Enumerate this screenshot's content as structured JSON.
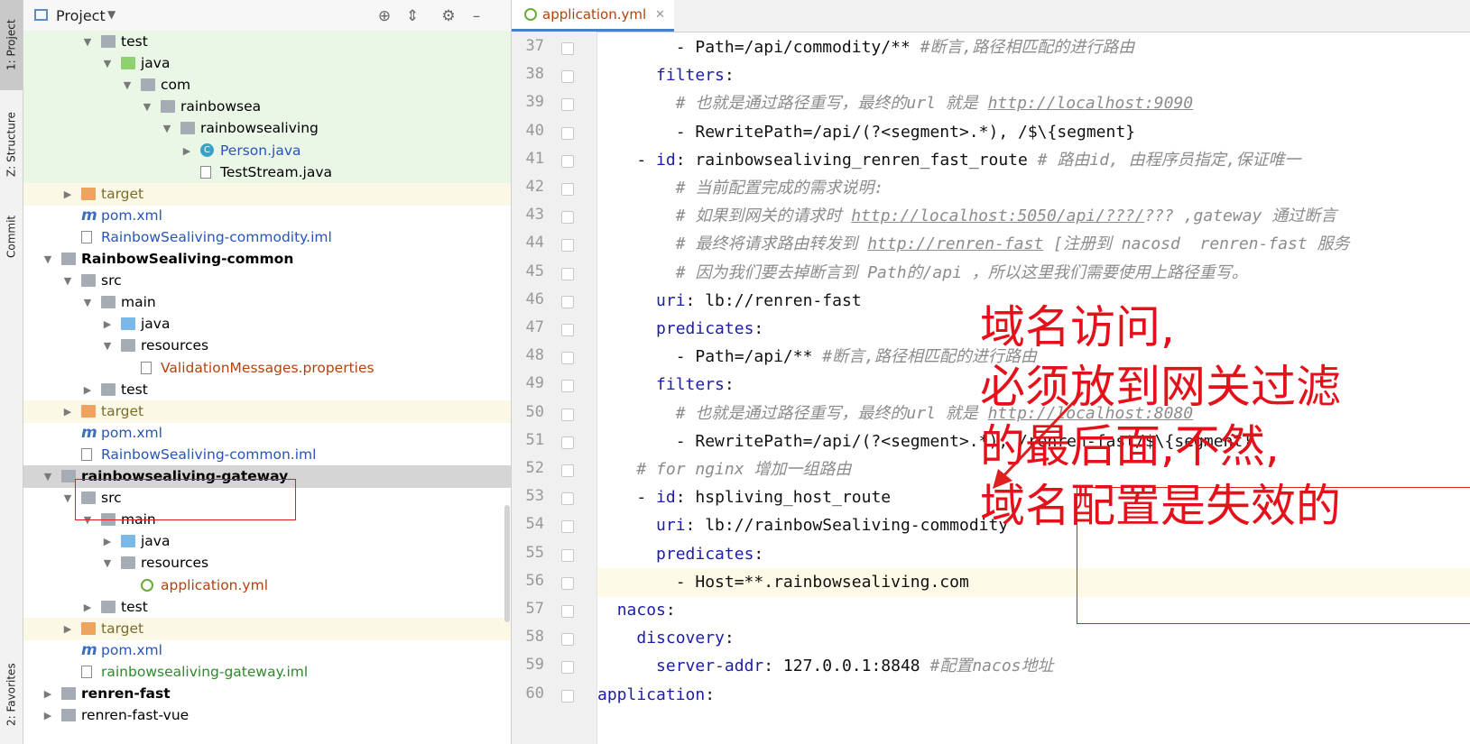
{
  "sidebar_tabs": [
    {
      "label": "1: Project"
    },
    {
      "label": "Z: Structure"
    },
    {
      "label": "Commit"
    },
    {
      "label": "2: Favorites"
    }
  ],
  "project_panel": {
    "title": "Project",
    "tree": [
      {
        "label": "test",
        "depth": 3,
        "arrow": "down",
        "icon": "folder",
        "bg": "green"
      },
      {
        "label": "java",
        "depth": 4,
        "arrow": "down",
        "icon": "folder-src",
        "bg": "green"
      },
      {
        "label": "com",
        "depth": 5,
        "arrow": "down",
        "icon": "package",
        "bg": "green"
      },
      {
        "label": "rainbowsea",
        "depth": 6,
        "arrow": "down",
        "icon": "package",
        "bg": "green"
      },
      {
        "label": "rainbowsealiving",
        "depth": 7,
        "arrow": "down",
        "icon": "package",
        "bg": "green"
      },
      {
        "label": "Person.java",
        "depth": 8,
        "arrow": "right",
        "icon": "class",
        "bg": "green",
        "color": "#2855b8"
      },
      {
        "label": "TestStream.java",
        "depth": 8,
        "arrow": "",
        "icon": "java-file",
        "bg": "green"
      },
      {
        "label": "target",
        "depth": 2,
        "arrow": "right",
        "icon": "folder-orange",
        "bg": "yellow",
        "color": "#7d6b2c"
      },
      {
        "label": "pom.xml",
        "depth": 2,
        "arrow": "",
        "icon": "maven",
        "bg": "",
        "color": "#2855b8"
      },
      {
        "label": "RainbowSealiving-commodity.iml",
        "depth": 2,
        "arrow": "",
        "icon": "iml",
        "bg": "",
        "color": "#2855b8"
      },
      {
        "label": "RainbowSealiving-common",
        "depth": 1,
        "arrow": "down",
        "icon": "module",
        "bg": "",
        "bold": true
      },
      {
        "label": "src",
        "depth": 2,
        "arrow": "down",
        "icon": "folder",
        "bg": ""
      },
      {
        "label": "main",
        "depth": 3,
        "arrow": "down",
        "icon": "folder",
        "bg": ""
      },
      {
        "label": "java",
        "depth": 4,
        "arrow": "right",
        "icon": "folder-blue",
        "bg": ""
      },
      {
        "label": "resources",
        "depth": 4,
        "arrow": "down",
        "icon": "folder-res",
        "bg": ""
      },
      {
        "label": "ValidationMessages.properties",
        "depth": 5,
        "arrow": "",
        "icon": "properties",
        "bg": "",
        "color": "#b5420c"
      },
      {
        "label": "test",
        "depth": 3,
        "arrow": "right",
        "icon": "folder",
        "bg": ""
      },
      {
        "label": "target",
        "depth": 2,
        "arrow": "right",
        "icon": "folder-orange",
        "bg": "yellow",
        "color": "#7d6b2c"
      },
      {
        "label": "pom.xml",
        "depth": 2,
        "arrow": "",
        "icon": "maven",
        "bg": "",
        "color": "#2855b8"
      },
      {
        "label": "RainbowSealiving-common.iml",
        "depth": 2,
        "arrow": "",
        "icon": "iml",
        "bg": "",
        "color": "#2855b8"
      },
      {
        "label": "rainbowsealiving-gateway",
        "depth": 1,
        "arrow": "down",
        "icon": "module",
        "bg": "selected",
        "bold": true
      },
      {
        "label": "src",
        "depth": 2,
        "arrow": "down",
        "icon": "folder",
        "bg": ""
      },
      {
        "label": "main",
        "depth": 3,
        "arrow": "down",
        "icon": "folder",
        "bg": ""
      },
      {
        "label": "java",
        "depth": 4,
        "arrow": "right",
        "icon": "folder-blue",
        "bg": ""
      },
      {
        "label": "resources",
        "depth": 4,
        "arrow": "down",
        "icon": "folder-res",
        "bg": ""
      },
      {
        "label": "application.yml",
        "depth": 5,
        "arrow": "",
        "icon": "yml",
        "bg": "",
        "color": "#b5420c"
      },
      {
        "label": "test",
        "depth": 3,
        "arrow": "right",
        "icon": "folder",
        "bg": ""
      },
      {
        "label": "target",
        "depth": 2,
        "arrow": "right",
        "icon": "folder-orange",
        "bg": "yellow",
        "color": "#7d6b2c"
      },
      {
        "label": "pom.xml",
        "depth": 2,
        "arrow": "",
        "icon": "maven",
        "bg": "",
        "color": "#2855b8"
      },
      {
        "label": "rainbowsealiving-gateway.iml",
        "depth": 2,
        "arrow": "",
        "icon": "iml",
        "bg": "",
        "color": "#2d8a2d"
      },
      {
        "label": "renren-fast",
        "depth": 1,
        "arrow": "right",
        "icon": "module",
        "bg": "",
        "bold": true
      },
      {
        "label": "renren-fast-vue",
        "depth": 1,
        "arrow": "right",
        "icon": "module",
        "bg": ""
      }
    ]
  },
  "editor": {
    "tab_label": "application.yml",
    "lines": [
      {
        "n": "37",
        "parts": [
          [
            "p",
            "        - Path=/api/commodity/** "
          ],
          [
            "c",
            "#断言,路径相匹配的进行路由"
          ]
        ]
      },
      {
        "n": "38",
        "parts": [
          [
            "p",
            "      "
          ],
          [
            "k",
            "filters"
          ],
          [
            "p",
            ":"
          ]
        ]
      },
      {
        "n": "39",
        "parts": [
          [
            "p",
            "        "
          ],
          [
            "c",
            "# 也就是通过路径重写，最终的url 就是 "
          ],
          [
            "cu",
            "http://localhost:9090"
          ]
        ]
      },
      {
        "n": "40",
        "parts": [
          [
            "p",
            "        - RewritePath=/api/(?<segment>.*), /$\\{segment}"
          ]
        ]
      },
      {
        "n": "41",
        "parts": [
          [
            "p",
            "    - "
          ],
          [
            "k",
            "id"
          ],
          [
            "p",
            ": rainbowsealiving_renren_fast_route "
          ],
          [
            "c",
            "# 路由id, 由程序员指定,保证唯一"
          ]
        ]
      },
      {
        "n": "42",
        "parts": [
          [
            "p",
            "        "
          ],
          [
            "c",
            "# 当前配置完成的需求说明:"
          ]
        ]
      },
      {
        "n": "43",
        "parts": [
          [
            "p",
            "        "
          ],
          [
            "c",
            "# 如果到网关的请求时 "
          ],
          [
            "cu",
            "http://localhost:5050/api/???/"
          ],
          [
            "c",
            "??? ,gateway 通过断言"
          ]
        ]
      },
      {
        "n": "44",
        "parts": [
          [
            "p",
            "        "
          ],
          [
            "c",
            "# 最终将请求路由转发到 "
          ],
          [
            "cu",
            "http://renren-fast"
          ],
          [
            "c",
            " [注册到 nacosd  renren-fast 服务"
          ]
        ]
      },
      {
        "n": "45",
        "parts": [
          [
            "p",
            "        "
          ],
          [
            "c",
            "# 因为我们要去掉断言到 Path的/api ，所以这里我们需要使用上路径重写。"
          ]
        ]
      },
      {
        "n": "46",
        "parts": [
          [
            "p",
            "      "
          ],
          [
            "k",
            "uri"
          ],
          [
            "p",
            ": lb://renren-fast"
          ]
        ]
      },
      {
        "n": "47",
        "parts": [
          [
            "p",
            "      "
          ],
          [
            "k",
            "predicates"
          ],
          [
            "p",
            ":"
          ]
        ]
      },
      {
        "n": "48",
        "parts": [
          [
            "p",
            "        - Path=/api/** "
          ],
          [
            "c",
            "#断言,路径相匹配的进行路由"
          ]
        ]
      },
      {
        "n": "49",
        "parts": [
          [
            "p",
            "      "
          ],
          [
            "k",
            "filters"
          ],
          [
            "p",
            ":"
          ]
        ]
      },
      {
        "n": "50",
        "parts": [
          [
            "p",
            "        "
          ],
          [
            "c",
            "# 也就是通过路径重写，最终的url 就是 "
          ],
          [
            "cu",
            "http://localhost:8080"
          ]
        ]
      },
      {
        "n": "51",
        "parts": [
          [
            "p",
            "        - RewritePath=/api/(?<segment>.*), /renren-fast/$\\{segment}"
          ]
        ]
      },
      {
        "n": "52",
        "parts": [
          [
            "p",
            "    "
          ],
          [
            "c",
            "# for nginx 增加一组路由"
          ]
        ]
      },
      {
        "n": "53",
        "parts": [
          [
            "p",
            "    - "
          ],
          [
            "k",
            "id"
          ],
          [
            "p",
            ": hspliving_host_route"
          ]
        ]
      },
      {
        "n": "54",
        "parts": [
          [
            "p",
            "      "
          ],
          [
            "k",
            "uri"
          ],
          [
            "p",
            ": lb://rainbowSealiving-commodity"
          ]
        ]
      },
      {
        "n": "55",
        "parts": [
          [
            "p",
            "      "
          ],
          [
            "k",
            "predicates"
          ],
          [
            "p",
            ":"
          ]
        ]
      },
      {
        "n": "56",
        "parts": [
          [
            "p",
            "        - Host=**.rainbowsealiving.com"
          ]
        ],
        "current": true
      },
      {
        "n": "57",
        "parts": [
          [
            "p",
            "  "
          ],
          [
            "k",
            "nacos"
          ],
          [
            "p",
            ":"
          ]
        ]
      },
      {
        "n": "58",
        "parts": [
          [
            "p",
            "    "
          ],
          [
            "k",
            "discovery"
          ],
          [
            "p",
            ":"
          ]
        ]
      },
      {
        "n": "59",
        "parts": [
          [
            "p",
            "      "
          ],
          [
            "k",
            "server-addr"
          ],
          [
            "p",
            ": 127.0.0.1:8848 "
          ],
          [
            "c",
            "#配置nacos地址"
          ]
        ]
      },
      {
        "n": "60",
        "parts": [
          [
            "k",
            "application"
          ],
          [
            "p",
            ":"
          ]
        ]
      }
    ]
  },
  "annotation": {
    "text": "域名访问,\n必须放到网关过滤\n的最后面,不然,\n域名配置是失效的"
  },
  "colors": {
    "keyword": "#1d1da9",
    "comment": "#8c8c8c",
    "annotation": "#e4101a"
  }
}
